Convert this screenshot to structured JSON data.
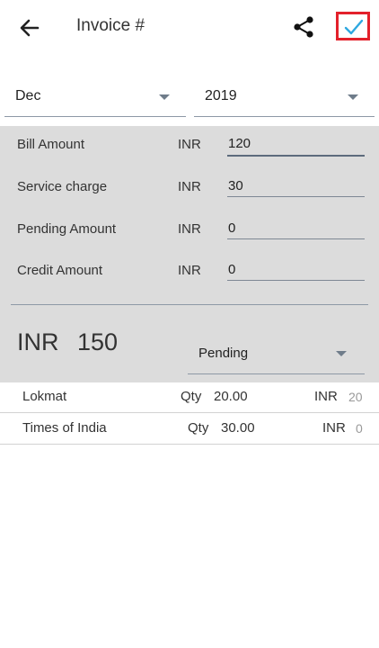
{
  "header": {
    "title": "Invoice #"
  },
  "period": {
    "month": "Dec",
    "year": "2019"
  },
  "bill_rows": [
    {
      "label": "Bill Amount",
      "currency": "INR",
      "value": "120"
    },
    {
      "label": "Service charge",
      "currency": "INR",
      "value": "30"
    },
    {
      "label": "Pending Amount",
      "currency": "INR",
      "value": "0"
    },
    {
      "label": "Credit Amount",
      "currency": "INR",
      "value": "0"
    }
  ],
  "total": {
    "currency": "INR",
    "value": "150",
    "status": "Pending"
  },
  "items": [
    {
      "name": "Lokmat",
      "qty_label": "Qty",
      "qty": "20.00",
      "currency": "INR",
      "amount": "20"
    },
    {
      "name": "Times of India",
      "qty_label": "Qty",
      "qty": "30.00",
      "currency": "INR",
      "amount": "0"
    }
  ],
  "colors": {
    "accent": "#2ea8e0",
    "highlight": "#e3212b",
    "panel": "#dcdcdc"
  }
}
